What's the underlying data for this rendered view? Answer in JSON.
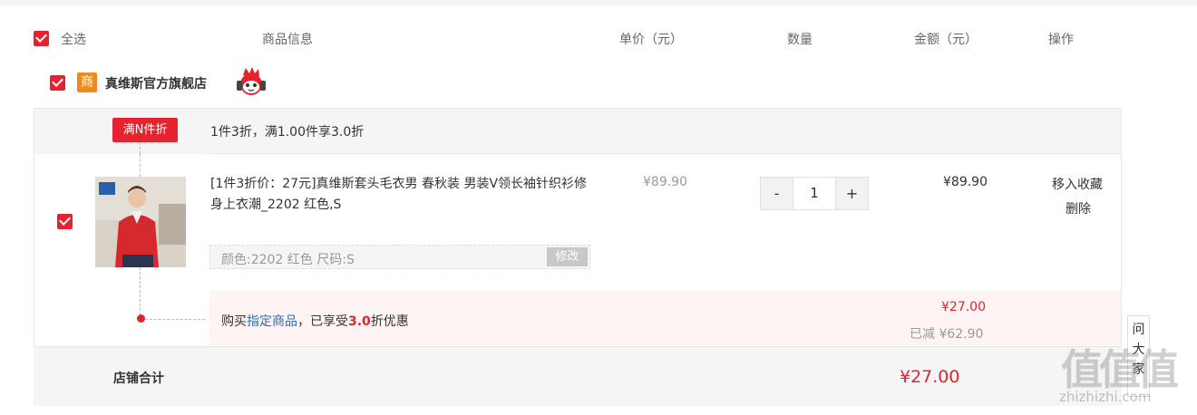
{
  "header": {
    "select_all": "全选",
    "col_product": "商品信息",
    "col_unit_price": "单价（元）",
    "col_quantity": "数量",
    "col_amount": "金额（元）",
    "col_actions": "操作"
  },
  "shop": {
    "icon_label": "商",
    "name": "真维斯官方旗舰店"
  },
  "promotion": {
    "tag": "满N件折",
    "text": "1件3折，满1.00件享3.0折"
  },
  "item": {
    "title": "[1件3折价：27元]真维斯套头毛衣男 春秋装 男装V领长袖针织衫修身上衣潮_2202 红色,S",
    "sku": "颜色:2202 红色   尺码:S",
    "sku_edit": "修改",
    "unit_price": "¥89.90",
    "quantity": "1",
    "qty_minus": "-",
    "qty_plus": "+",
    "amount": "¥89.90",
    "action_favorite": "移入收藏",
    "action_delete": "删除"
  },
  "discount": {
    "prefix": "购买",
    "link": "指定商品",
    "middle": "，已享受",
    "rate": "3.0",
    "suffix": "折优惠",
    "price": "¥27.00",
    "saved": "已减 ¥62.90"
  },
  "total": {
    "label": "店铺合计",
    "value": "¥27.00"
  },
  "side_widget": {
    "text": "问大家"
  },
  "watermark": {
    "logo": "值值值",
    "site": "zhizhizhi.com"
  },
  "colors": {
    "accent": "#e5232e",
    "shop_icon": "#f08a1c",
    "link": "#2b6cb0"
  }
}
